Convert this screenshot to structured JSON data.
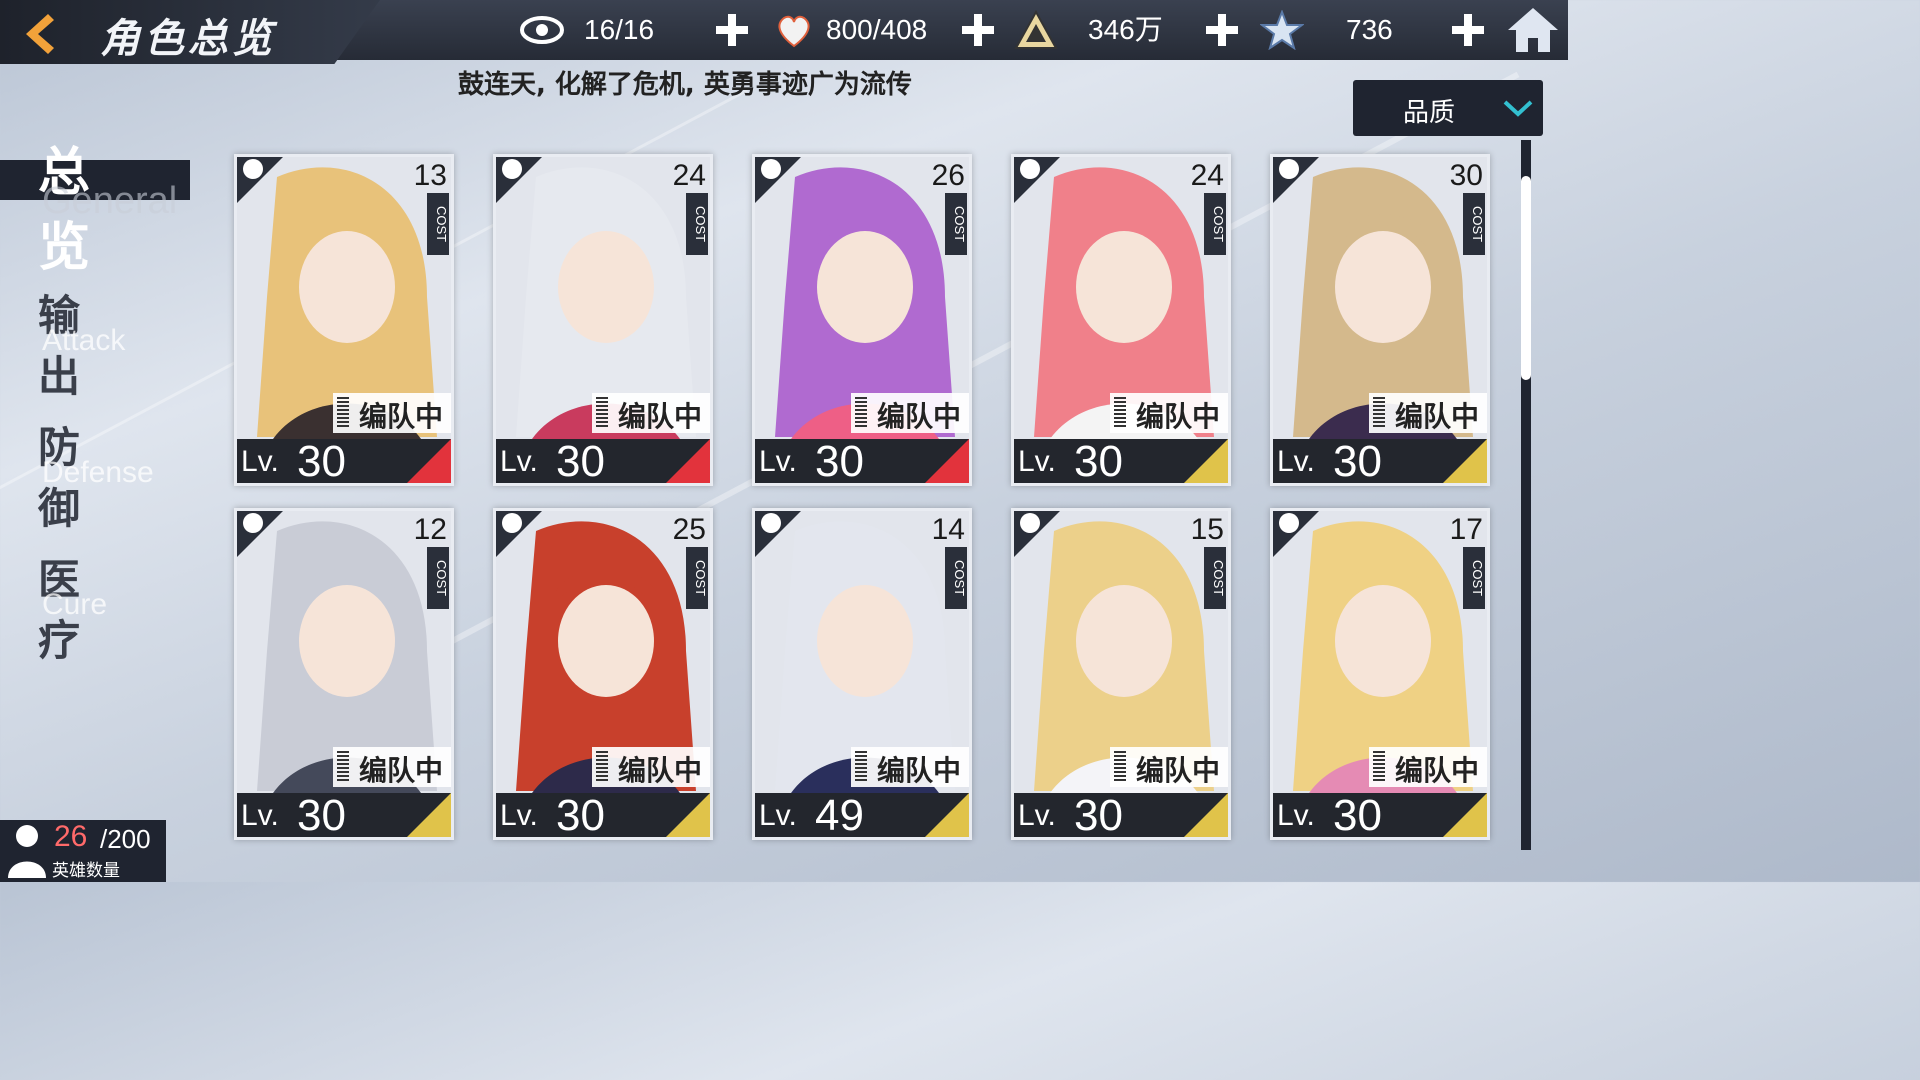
{
  "header": {
    "title": "角色总览",
    "back_icon": "back-arrow-icon",
    "resources": [
      {
        "name": "visibility",
        "icon": "eye-icon",
        "value": "16/16"
      },
      {
        "name": "stamina",
        "icon": "heart-hand-icon",
        "value": "800/408"
      },
      {
        "name": "gold",
        "icon": "pyramid-icon",
        "value": "346万"
      },
      {
        "name": "stars",
        "icon": "star-icon",
        "value": "736"
      }
    ],
    "home_icon": "home-icon"
  },
  "marquee": "鼓连天, 化解了危机, 英勇事迹广为流传",
  "sort": {
    "label": "品质",
    "icon": "chevron-down-icon"
  },
  "sidebar": {
    "items": [
      {
        "cn": "总览",
        "en": "General",
        "active": true
      },
      {
        "cn": "输出",
        "en": "Attack",
        "active": false
      },
      {
        "cn": "防御",
        "en": "Defense",
        "active": false
      },
      {
        "cn": "医疗",
        "en": "Cure",
        "active": false
      }
    ]
  },
  "cards": [
    {
      "cost": "13",
      "cost_label": "COST",
      "team": "编队中",
      "lv_prefix": "Lv.",
      "level": "30",
      "rarity": "red",
      "class_icon": "dragon-icon",
      "hair": "#e8c27a",
      "accent": "#3a3030"
    },
    {
      "cost": "24",
      "cost_label": "COST",
      "team": "编队中",
      "lv_prefix": "Lv.",
      "level": "30",
      "rarity": "red",
      "class_icon": "demon-horns-icon",
      "hair": "#e6e9ef",
      "accent": "#c93b5e"
    },
    {
      "cost": "26",
      "cost_label": "COST",
      "team": "编队中",
      "lv_prefix": "Lv.",
      "level": "30",
      "rarity": "red",
      "class_icon": "pistol-icon",
      "hair": "#b06ad0",
      "accent": "#ee5f86"
    },
    {
      "cost": "24",
      "cost_label": "COST",
      "team": "编队中",
      "lv_prefix": "Lv.",
      "level": "30",
      "rarity": "gold",
      "class_icon": "crown-sword-icon",
      "hair": "#f0808a",
      "accent": "#f4f4f4"
    },
    {
      "cost": "30",
      "cost_label": "COST",
      "team": "编队中",
      "lv_prefix": "Lv.",
      "level": "30",
      "rarity": "gold",
      "class_icon": "flame-icon",
      "hair": "#d4b98c",
      "accent": "#3b2c4e"
    },
    {
      "cost": "12",
      "cost_label": "COST",
      "team": "编队中",
      "lv_prefix": "Lv.",
      "level": "30",
      "rarity": "gold",
      "class_icon": "sword-icon",
      "hair": "#c9ccd6",
      "accent": "#44495a"
    },
    {
      "cost": "25",
      "cost_label": "COST",
      "team": "编队中",
      "lv_prefix": "Lv.",
      "level": "30",
      "rarity": "gold",
      "class_icon": "pistol-icon",
      "hair": "#c8402c",
      "accent": "#2d2a4a"
    },
    {
      "cost": "14",
      "cost_label": "COST",
      "team": "编队中",
      "lv_prefix": "Lv.",
      "level": "49",
      "rarity": "gold",
      "class_icon": "crossbow-icon",
      "hair": "#e3e6ee",
      "accent": "#2a2f5c"
    },
    {
      "cost": "15",
      "cost_label": "COST",
      "team": "编队中",
      "lv_prefix": "Lv.",
      "level": "30",
      "rarity": "gold",
      "class_icon": "snowflake-icon",
      "hair": "#ecd08a",
      "accent": "#f4f4f8"
    },
    {
      "cost": "17",
      "cost_label": "COST",
      "team": "编队中",
      "lv_prefix": "Lv.",
      "level": "30",
      "rarity": "gold",
      "class_icon": "heart-wings-icon",
      "hair": "#efd184",
      "accent": "#e58bb4"
    }
  ],
  "hero_count": {
    "current": "26",
    "max": "/200",
    "label": "英雄数量",
    "icon": "person-icon"
  }
}
